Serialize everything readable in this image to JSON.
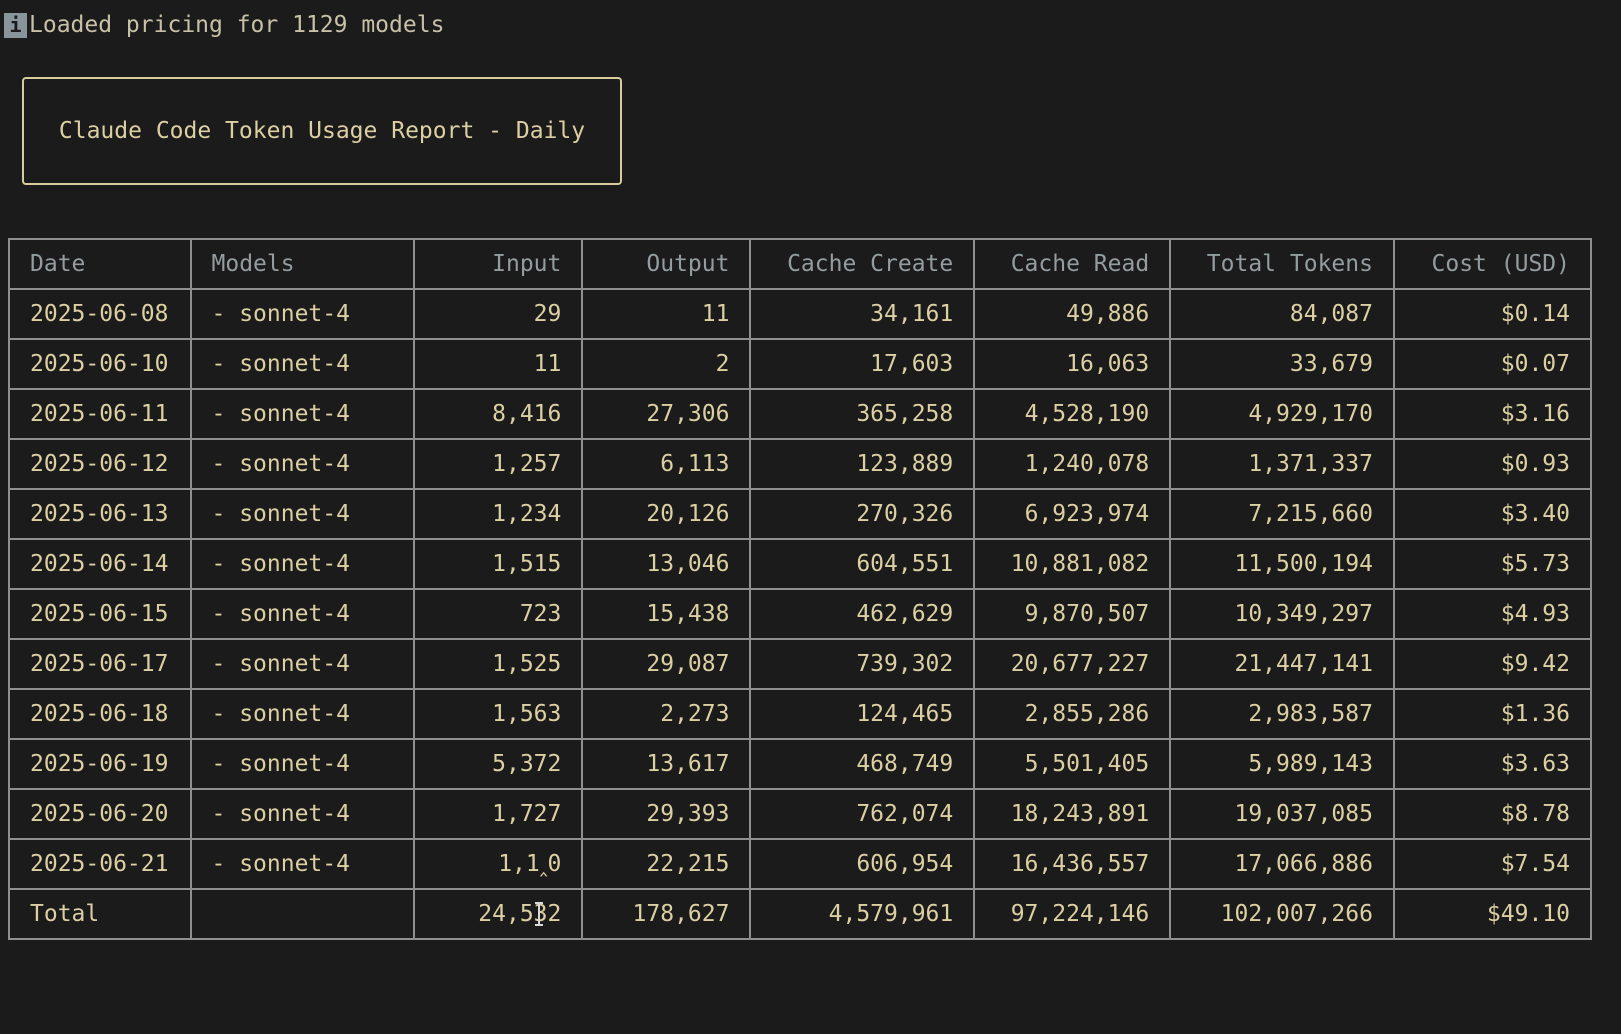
{
  "status": {
    "icon": "info-icon",
    "icon_glyph": "i",
    "message": "Loaded pricing for 1129 models"
  },
  "title": "Claude Code Token Usage Report - Daily",
  "table": {
    "headers": [
      "Date",
      "Models",
      "Input",
      "Output",
      "Cache Create",
      "Cache Read",
      "Total Tokens",
      "Cost (USD)"
    ],
    "rows": [
      [
        "2025-06-08",
        "- sonnet-4",
        "29",
        "11",
        "34,161",
        "49,886",
        "84,087",
        "$0.14"
      ],
      [
        "2025-06-10",
        "- sonnet-4",
        "11",
        "2",
        "17,603",
        "16,063",
        "33,679",
        "$0.07"
      ],
      [
        "2025-06-11",
        "- sonnet-4",
        "8,416",
        "27,306",
        "365,258",
        "4,528,190",
        "4,929,170",
        "$3.16"
      ],
      [
        "2025-06-12",
        "- sonnet-4",
        "1,257",
        "6,113",
        "123,889",
        "1,240,078",
        "1,371,337",
        "$0.93"
      ],
      [
        "2025-06-13",
        "- sonnet-4",
        "1,234",
        "20,126",
        "270,326",
        "6,923,974",
        "7,215,660",
        "$3.40"
      ],
      [
        "2025-06-14",
        "- sonnet-4",
        "1,515",
        "13,046",
        "604,551",
        "10,881,082",
        "11,500,194",
        "$5.73"
      ],
      [
        "2025-06-15",
        "- sonnet-4",
        "723",
        "15,438",
        "462,629",
        "9,870,507",
        "10,349,297",
        "$4.93"
      ],
      [
        "2025-06-17",
        "- sonnet-4",
        "1,525",
        "29,087",
        "739,302",
        "20,677,227",
        "21,447,141",
        "$9.42"
      ],
      [
        "2025-06-18",
        "- sonnet-4",
        "1,563",
        "2,273",
        "124,465",
        "2,855,286",
        "2,983,587",
        "$1.36"
      ],
      [
        "2025-06-19",
        "- sonnet-4",
        "5,372",
        "13,617",
        "468,749",
        "5,501,405",
        "5,989,143",
        "$3.63"
      ],
      [
        "2025-06-20",
        "- sonnet-4",
        "1,727",
        "29,393",
        "762,074",
        "18,243,891",
        "19,037,085",
        "$8.78"
      ],
      [
        "2025-06-21",
        "- sonnet-4",
        "1,1‸0",
        "22,215",
        "606,954",
        "16,436,557",
        "17,066,886",
        "$7.54"
      ]
    ],
    "total": [
      "Total",
      "",
      "24,532",
      "178,627",
      "4,579,961",
      "97,224,146",
      "102,007,266",
      "$49.10"
    ]
  },
  "cursor": "text-cursor-icon"
}
